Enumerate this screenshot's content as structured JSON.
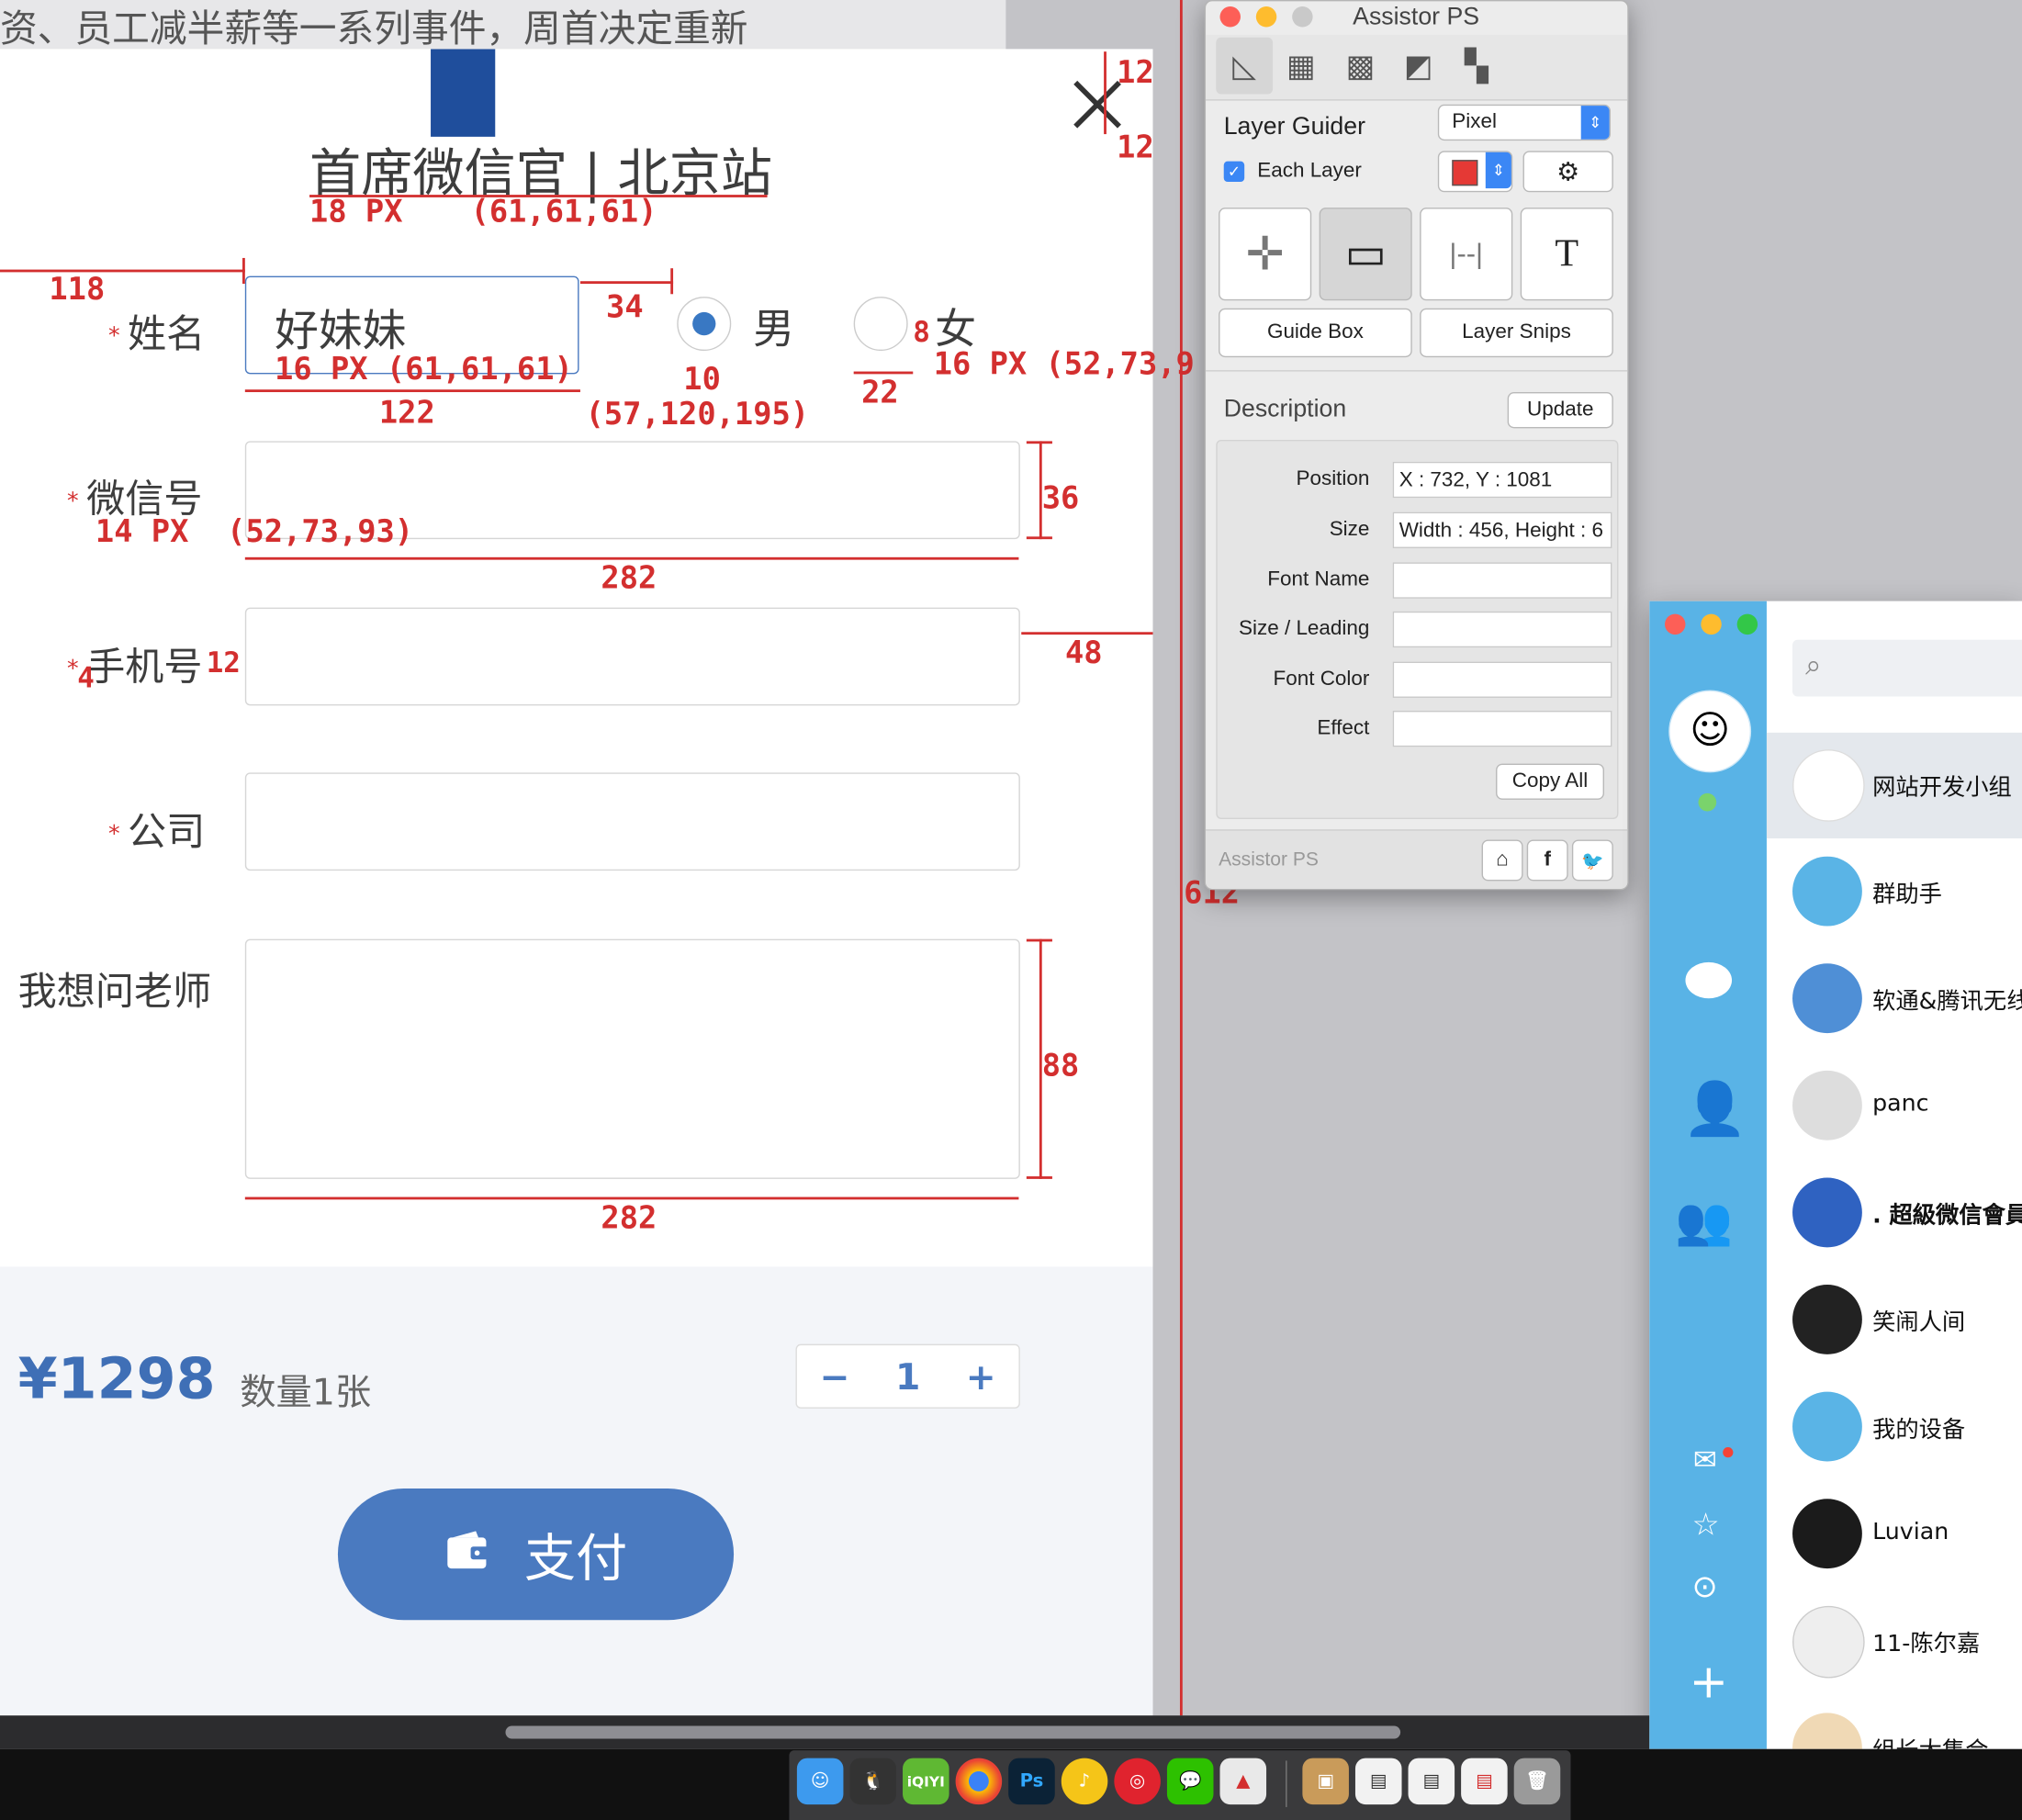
{
  "background_article": {
    "text": "资、员工减半薪等一系列事件，周首决定重新"
  },
  "form": {
    "title": "首席微信官 | 北京站",
    "name_label": "姓名",
    "name_value": "好妹妹",
    "gender_male": "男",
    "gender_female": "女",
    "selected_gender": "男",
    "wechat_label": "微信号",
    "phone_label": "手机号",
    "company_label": "公司",
    "question_label": "我想问老师",
    "required_mark": "*",
    "price": "¥1298",
    "quantity_text": "数量1张",
    "stepper_minus": "−",
    "stepper_value": "1",
    "stepper_plus": "+",
    "pay_label": "支付",
    "close_icon": "close-icon"
  },
  "annotations": {
    "title_spec": "18 PX",
    "title_color": "(61,61,61)",
    "name_spec": "16 PX (61,61,61)",
    "label_spec": "14 PX",
    "label_color": "(52,73,93)",
    "radio_color": "(57,120,195)",
    "female_spec": "16 PX (52,73,9",
    "d_left": "118",
    "d_gap": "34",
    "d_input_w": "122",
    "d_radio": "10",
    "d_radio_gap": "22",
    "d_f8": "8",
    "d_top1": "12",
    "d_top2": "12",
    "d_height36": "36",
    "d_width282a": "282",
    "d_48": "48",
    "d_4": "4",
    "d_12b": "12",
    "d_88": "88",
    "d_width282b": "282",
    "d_612": "612"
  },
  "assistor": {
    "window_title": "Assistor PS",
    "layer_guider_label": "Layer Guider",
    "unit_select": "Pixel",
    "each_layer_label": "Each Layer",
    "each_layer_checked": true,
    "guide_box_label": "Guide Box",
    "layer_snips_label": "Layer Snips",
    "description_label": "Description",
    "update_button": "Update",
    "position_label": "Position",
    "position_value": "X : 732, Y : 1081",
    "size_label": "Size",
    "size_value": "Width : 456, Height : 6",
    "font_name_label": "Font Name",
    "size_leading_label": "Size / Leading",
    "font_color_label": "Font Color",
    "effect_label": "Effect",
    "copy_all_button": "Copy All",
    "footer_label": "Assistor PS",
    "swatch_color": "#e53935"
  },
  "qq": {
    "contacts": [
      {
        "name": "网站开发小组"
      },
      {
        "name": "群助手"
      },
      {
        "name": "软通&腾讯无线"
      },
      {
        "name": "panc"
      },
      {
        "name": ". 超級微信會員"
      },
      {
        "name": "笑闹人间"
      },
      {
        "name": "我的设备"
      },
      {
        "name": "Luvian"
      },
      {
        "name": "11-陈尔嘉"
      },
      {
        "name": "组长大集合"
      }
    ]
  },
  "dock": {
    "iqiyi_label": "iQIYI",
    "ps_label": "Ps"
  },
  "colors": {
    "accent": "#4a7ac0",
    "annotation": "#d32f2f",
    "qq_side": "#59b3e6"
  }
}
